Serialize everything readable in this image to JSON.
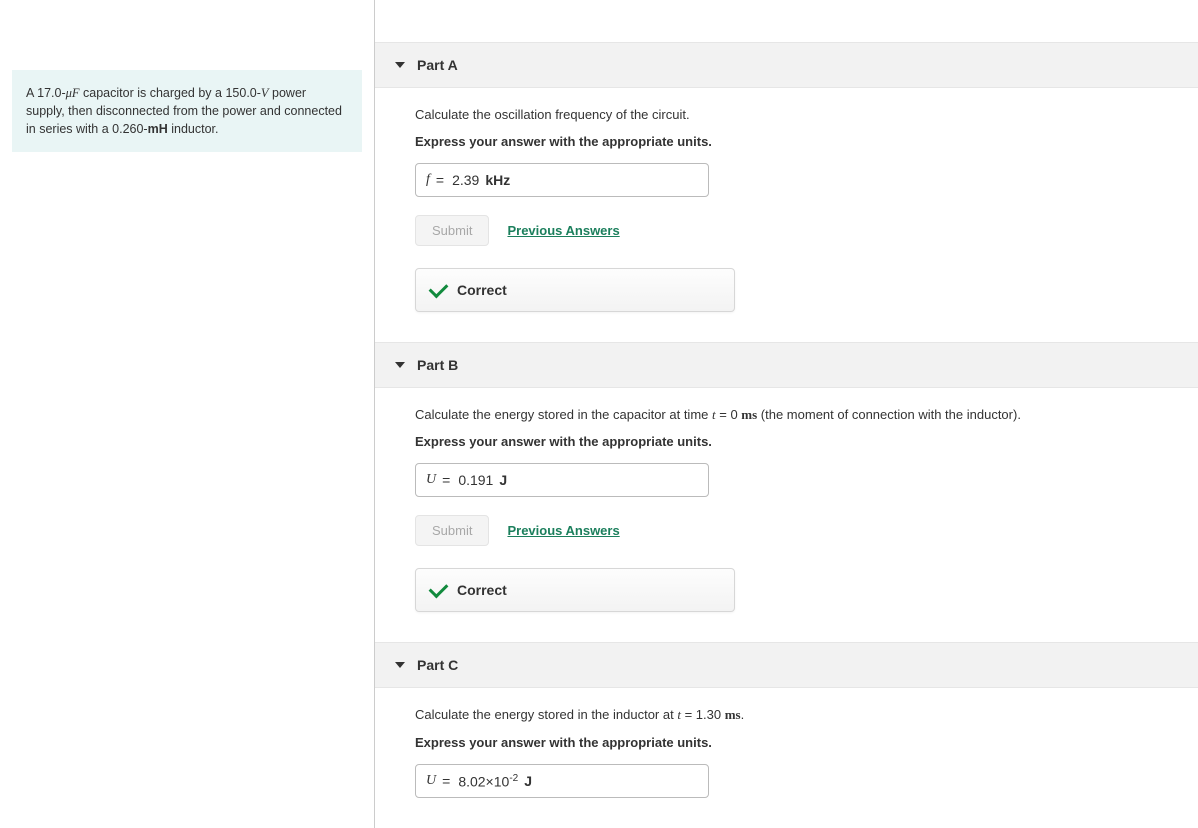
{
  "intro": {
    "pre": "A 17.0-",
    "sym1_html": "<span class='inline-math'>μF</span>",
    "mid1": " capacitor is charged by a 150.0-",
    "sym2_html": "<span class='inline-math'>V</span>",
    "mid2": " power supply, then disconnected from the power and connected in series with a 0.260-",
    "sym3_html": "<span class='bold'>mH</span>",
    "post": " inductor."
  },
  "labels": {
    "submit": "Submit",
    "previous": "Previous Answers",
    "correct": "Correct",
    "express": "Express your answer with the appropriate units."
  },
  "parts": [
    {
      "title": "Part A",
      "prompt_html": "Calculate the oscillation frequency of the circuit.",
      "var": "f",
      "value_html": "2.39",
      "unit": "kHz",
      "show_feedback": true
    },
    {
      "title": "Part B",
      "prompt_html": "Calculate the energy stored in the capacitor at time <span class='mi'>t</span> = 0 <span class='mb'>ms</span> (the moment of connection with the inductor).",
      "var": "U",
      "value_html": "0.191",
      "unit": "J",
      "show_feedback": true
    },
    {
      "title": "Part C",
      "prompt_html": "Calculate the energy stored in the inductor at <span class='mi'>t</span> = 1.30 <span class='mb'>ms</span>.",
      "var": "U",
      "value_html": "8.02×10<sup>-2</sup>",
      "unit": "J",
      "show_feedback": false
    }
  ]
}
